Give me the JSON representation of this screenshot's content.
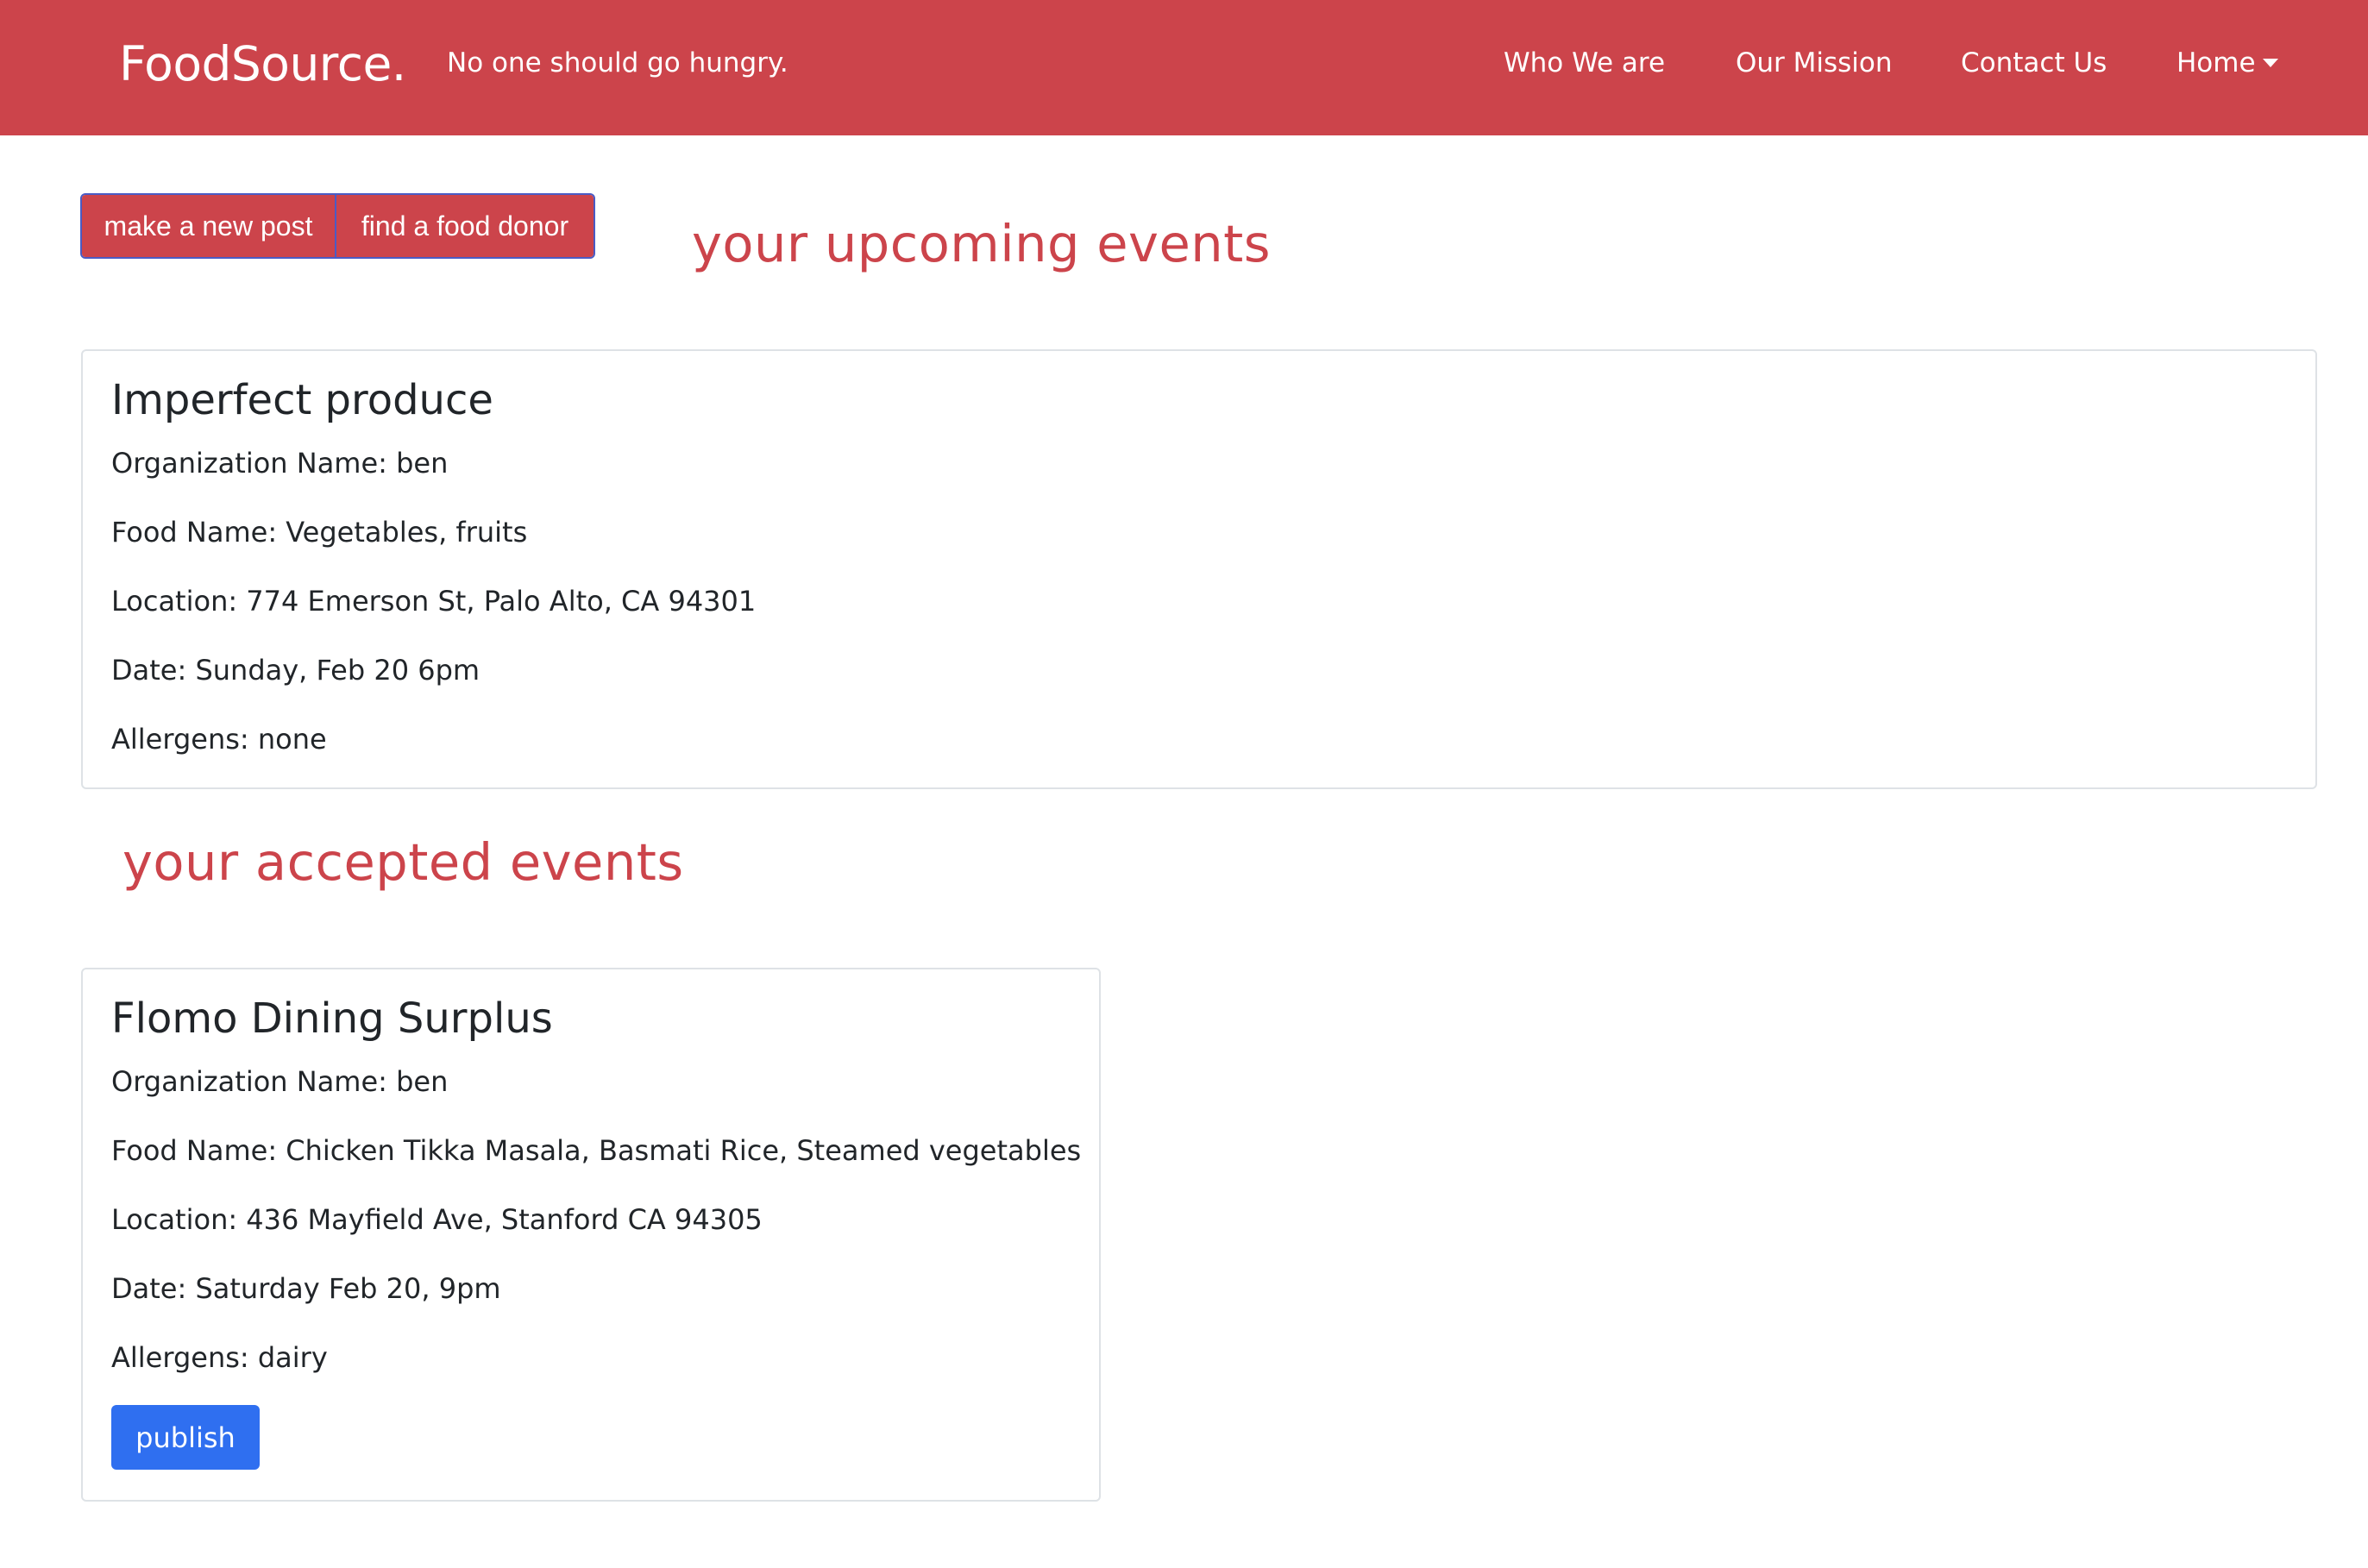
{
  "navbar": {
    "brand": "FoodSource.",
    "tagline": "No one should go hungry.",
    "links": [
      "Who We are",
      "Our Mission",
      "Contact Us",
      "Home"
    ],
    "color": "#cc444b"
  },
  "actions": {
    "new_post": "make a new post",
    "find_donor": "find a food donor"
  },
  "upcoming": {
    "heading": "your upcoming events",
    "card": {
      "title": "Imperfect produce",
      "organization": "Organization Name: ben",
      "food": "Food Name: Vegetables, fruits",
      "location": "Location: 774 Emerson St, Palo Alto, CA 94301",
      "date": "Date: Sunday, Feb 20 6pm",
      "allergens": "Allergens: none"
    }
  },
  "accepted": {
    "heading": "your accepted events",
    "card": {
      "title": "Flomo Dining Surplus",
      "organization": "Organization Name: ben",
      "food": "Food Name: Chicken Tikka Masala, Basmati Rice, Steamed vegetables",
      "location": "Location: 436 Mayfield Ave, Stanford CA 94305",
      "date": "Date: Saturday Feb 20, 9pm",
      "allergens": "Allergens: dairy",
      "publish_label": "publish"
    }
  },
  "colors": {
    "accent": "#cc444b",
    "primary_button": "#2f6ff0"
  }
}
